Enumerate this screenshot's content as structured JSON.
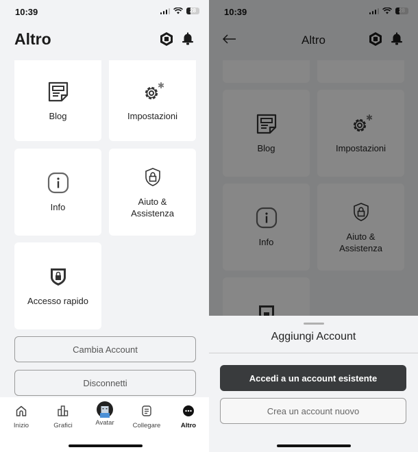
{
  "status_bar": {
    "time": "10:39",
    "battery": "28"
  },
  "left_screen": {
    "header": {
      "title": "Altro",
      "icons": [
        "robux-icon",
        "bell-icon"
      ]
    },
    "tiles": [
      {
        "label": "Blog",
        "icon": "blog-icon"
      },
      {
        "label": "Impostazioni",
        "icon": "settings-gear-icon"
      },
      {
        "label": "Info",
        "icon": "info-icon"
      },
      {
        "label": "Aiuto & Assistenza",
        "icon": "shield-lock-outline-icon"
      },
      {
        "label": "Accesso rapido",
        "icon": "shield-lock-filled-icon"
      }
    ],
    "buttons": {
      "switch_account": "Cambia Account",
      "logout": "Disconnetti"
    },
    "tabbar": [
      {
        "label": "Inizio",
        "icon": "home-icon",
        "active": false
      },
      {
        "label": "Grafici",
        "icon": "charts-icon",
        "active": false
      },
      {
        "label": "Avatar",
        "icon": "avatar-icon",
        "active": false
      },
      {
        "label": "Collegare",
        "icon": "connect-icon",
        "active": false
      },
      {
        "label": "Altro",
        "icon": "more-icon",
        "active": true
      }
    ]
  },
  "right_screen": {
    "header": {
      "title": "Altro",
      "back": "back-arrow-icon"
    },
    "background_tiles": [
      "Blog",
      "Impostazioni",
      "Info",
      "Aiuto & Assistenza"
    ],
    "sheet": {
      "title": "Aggiungi Account",
      "primary_button": "Accedi a un account esistente",
      "secondary_button": "Crea un account nuovo"
    }
  }
}
